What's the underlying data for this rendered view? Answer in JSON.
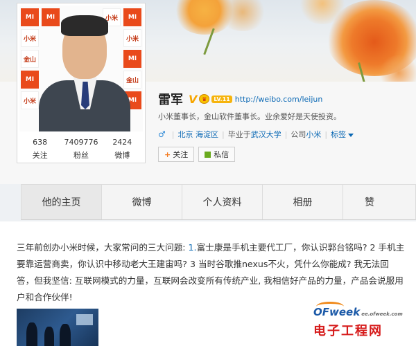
{
  "profile": {
    "name": "雷军",
    "verified_badge": "V",
    "level": "LV.11",
    "url": "http://weibo.com/leijun",
    "bio": "小米董事长，金山软件董事长。业余爱好是天使投资。",
    "gender_symbol": "♂",
    "location": "北京 海淀区",
    "school_prefix": "毕业于",
    "school": "武汉大学",
    "company_prefix": "公司",
    "company": "小米",
    "tags_label": "标签",
    "follow_button": "关注",
    "message_button": "私信",
    "avatar_tiles": [
      "MI",
      "小米",
      "金山",
      "MI",
      "小米",
      "金山"
    ]
  },
  "stats": [
    {
      "value": "638",
      "label": "关注"
    },
    {
      "value": "7409776",
      "label": "粉丝"
    },
    {
      "value": "2424",
      "label": "微博"
    }
  ],
  "tabs": [
    {
      "label": "他的主页"
    },
    {
      "label": "微博"
    },
    {
      "label": "个人资料"
    },
    {
      "label": "相册"
    },
    {
      "label": "赞"
    }
  ],
  "post": {
    "text_1": "三年前创办小米时候，大家常问的三大问题: ",
    "num_1": "1.",
    "text_2": "富士康是手机主要代工厂，你认识郭台铭吗? 2 手机主要靠运营商卖，你认识中移动老大王建宙吗? 3 当时谷歌推nexus不火，凭什么你能成? 我无法回答，但我坚信: 互联网模式的力量，互联网会改变所有传统产业, 我相信好产品的力量，产品会说服用户和合作伙伴!"
  },
  "watermark": {
    "brand_o": "O",
    "brand_rest": "Fweek",
    "url": "ee.ofweek.com",
    "cn": "电子工程网"
  },
  "colors": {
    "link_blue": "#0a68b4",
    "badge_gold": "#f7a600",
    "follow_plus": "#f47b20",
    "watermark_red": "#d61b1b"
  }
}
